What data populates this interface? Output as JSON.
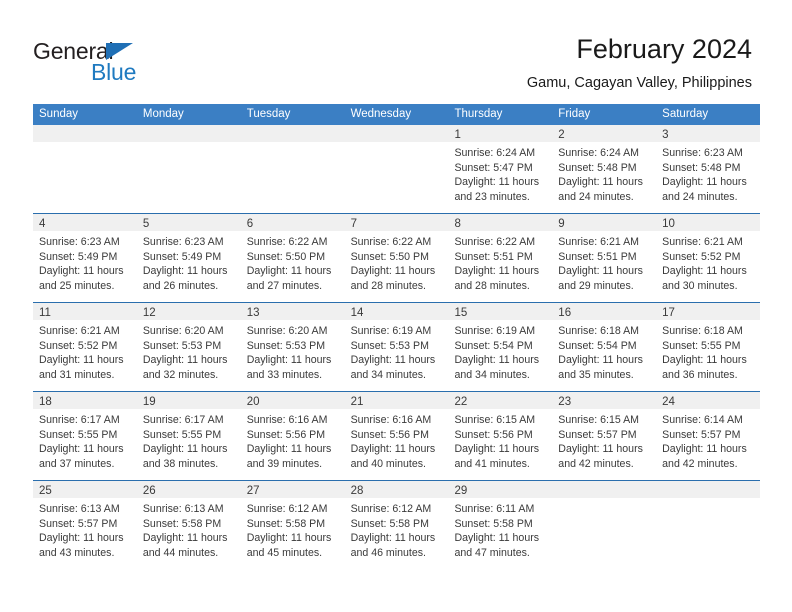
{
  "brand": {
    "name_part1": "General",
    "name_part2": "Blue",
    "triangle_color": "#1f6fb5",
    "blue_text_color": "#1f7ac0"
  },
  "header": {
    "title": "February 2024",
    "subtitle": "Gamu, Cagayan Valley, Philippines"
  },
  "theme": {
    "header_blue": "#3b7fc4",
    "row_divider_blue": "#2a6ead",
    "daynum_band_gray": "#f0f0f0"
  },
  "weekdays": [
    "Sunday",
    "Monday",
    "Tuesday",
    "Wednesday",
    "Thursday",
    "Friday",
    "Saturday"
  ],
  "weeks": [
    [
      {
        "day": "",
        "lines": []
      },
      {
        "day": "",
        "lines": []
      },
      {
        "day": "",
        "lines": []
      },
      {
        "day": "",
        "lines": []
      },
      {
        "day": "1",
        "lines": [
          "Sunrise: 6:24 AM",
          "Sunset: 5:47 PM",
          "Daylight: 11 hours",
          "and 23 minutes."
        ]
      },
      {
        "day": "2",
        "lines": [
          "Sunrise: 6:24 AM",
          "Sunset: 5:48 PM",
          "Daylight: 11 hours",
          "and 24 minutes."
        ]
      },
      {
        "day": "3",
        "lines": [
          "Sunrise: 6:23 AM",
          "Sunset: 5:48 PM",
          "Daylight: 11 hours",
          "and 24 minutes."
        ]
      }
    ],
    [
      {
        "day": "4",
        "lines": [
          "Sunrise: 6:23 AM",
          "Sunset: 5:49 PM",
          "Daylight: 11 hours",
          "and 25 minutes."
        ]
      },
      {
        "day": "5",
        "lines": [
          "Sunrise: 6:23 AM",
          "Sunset: 5:49 PM",
          "Daylight: 11 hours",
          "and 26 minutes."
        ]
      },
      {
        "day": "6",
        "lines": [
          "Sunrise: 6:22 AM",
          "Sunset: 5:50 PM",
          "Daylight: 11 hours",
          "and 27 minutes."
        ]
      },
      {
        "day": "7",
        "lines": [
          "Sunrise: 6:22 AM",
          "Sunset: 5:50 PM",
          "Daylight: 11 hours",
          "and 28 minutes."
        ]
      },
      {
        "day": "8",
        "lines": [
          "Sunrise: 6:22 AM",
          "Sunset: 5:51 PM",
          "Daylight: 11 hours",
          "and 28 minutes."
        ]
      },
      {
        "day": "9",
        "lines": [
          "Sunrise: 6:21 AM",
          "Sunset: 5:51 PM",
          "Daylight: 11 hours",
          "and 29 minutes."
        ]
      },
      {
        "day": "10",
        "lines": [
          "Sunrise: 6:21 AM",
          "Sunset: 5:52 PM",
          "Daylight: 11 hours",
          "and 30 minutes."
        ]
      }
    ],
    [
      {
        "day": "11",
        "lines": [
          "Sunrise: 6:21 AM",
          "Sunset: 5:52 PM",
          "Daylight: 11 hours",
          "and 31 minutes."
        ]
      },
      {
        "day": "12",
        "lines": [
          "Sunrise: 6:20 AM",
          "Sunset: 5:53 PM",
          "Daylight: 11 hours",
          "and 32 minutes."
        ]
      },
      {
        "day": "13",
        "lines": [
          "Sunrise: 6:20 AM",
          "Sunset: 5:53 PM",
          "Daylight: 11 hours",
          "and 33 minutes."
        ]
      },
      {
        "day": "14",
        "lines": [
          "Sunrise: 6:19 AM",
          "Sunset: 5:53 PM",
          "Daylight: 11 hours",
          "and 34 minutes."
        ]
      },
      {
        "day": "15",
        "lines": [
          "Sunrise: 6:19 AM",
          "Sunset: 5:54 PM",
          "Daylight: 11 hours",
          "and 34 minutes."
        ]
      },
      {
        "day": "16",
        "lines": [
          "Sunrise: 6:18 AM",
          "Sunset: 5:54 PM",
          "Daylight: 11 hours",
          "and 35 minutes."
        ]
      },
      {
        "day": "17",
        "lines": [
          "Sunrise: 6:18 AM",
          "Sunset: 5:55 PM",
          "Daylight: 11 hours",
          "and 36 minutes."
        ]
      }
    ],
    [
      {
        "day": "18",
        "lines": [
          "Sunrise: 6:17 AM",
          "Sunset: 5:55 PM",
          "Daylight: 11 hours",
          "and 37 minutes."
        ]
      },
      {
        "day": "19",
        "lines": [
          "Sunrise: 6:17 AM",
          "Sunset: 5:55 PM",
          "Daylight: 11 hours",
          "and 38 minutes."
        ]
      },
      {
        "day": "20",
        "lines": [
          "Sunrise: 6:16 AM",
          "Sunset: 5:56 PM",
          "Daylight: 11 hours",
          "and 39 minutes."
        ]
      },
      {
        "day": "21",
        "lines": [
          "Sunrise: 6:16 AM",
          "Sunset: 5:56 PM",
          "Daylight: 11 hours",
          "and 40 minutes."
        ]
      },
      {
        "day": "22",
        "lines": [
          "Sunrise: 6:15 AM",
          "Sunset: 5:56 PM",
          "Daylight: 11 hours",
          "and 41 minutes."
        ]
      },
      {
        "day": "23",
        "lines": [
          "Sunrise: 6:15 AM",
          "Sunset: 5:57 PM",
          "Daylight: 11 hours",
          "and 42 minutes."
        ]
      },
      {
        "day": "24",
        "lines": [
          "Sunrise: 6:14 AM",
          "Sunset: 5:57 PM",
          "Daylight: 11 hours",
          "and 42 minutes."
        ]
      }
    ],
    [
      {
        "day": "25",
        "lines": [
          "Sunrise: 6:13 AM",
          "Sunset: 5:57 PM",
          "Daylight: 11 hours",
          "and 43 minutes."
        ]
      },
      {
        "day": "26",
        "lines": [
          "Sunrise: 6:13 AM",
          "Sunset: 5:58 PM",
          "Daylight: 11 hours",
          "and 44 minutes."
        ]
      },
      {
        "day": "27",
        "lines": [
          "Sunrise: 6:12 AM",
          "Sunset: 5:58 PM",
          "Daylight: 11 hours",
          "and 45 minutes."
        ]
      },
      {
        "day": "28",
        "lines": [
          "Sunrise: 6:12 AM",
          "Sunset: 5:58 PM",
          "Daylight: 11 hours",
          "and 46 minutes."
        ]
      },
      {
        "day": "29",
        "lines": [
          "Sunrise: 6:11 AM",
          "Sunset: 5:58 PM",
          "Daylight: 11 hours",
          "and 47 minutes."
        ]
      },
      {
        "day": "",
        "lines": []
      },
      {
        "day": "",
        "lines": []
      }
    ]
  ]
}
